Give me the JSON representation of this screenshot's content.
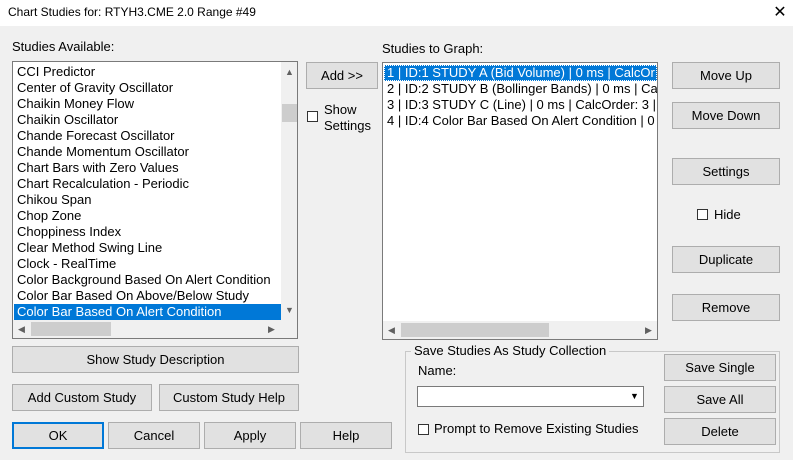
{
  "window": {
    "title": "Chart Studies for: RTYH3.CME  2.0 Range  #49",
    "close_glyph": "✕"
  },
  "available": {
    "label": "Studies Available:",
    "items": [
      "CCI Predictor",
      "Center of Gravity Oscillator",
      "Chaikin Money Flow",
      "Chaikin Oscillator",
      "Chande Forecast Oscillator",
      "Chande Momentum Oscillator",
      "Chart Bars with Zero Values",
      "Chart Recalculation - Periodic",
      "Chikou Span",
      "Chop Zone",
      "Choppiness Index",
      "Clear Method Swing Line",
      "Clock - RealTime",
      "Color Background Based On Alert Condition",
      "Color Bar Based On Above/Below Study",
      "Color Bar Based On Alert Condition"
    ],
    "selected_index": 15
  },
  "middle": {
    "add_label": "Add >>",
    "show_settings_label_1": "Show",
    "show_settings_label_2": "Settings"
  },
  "graph": {
    "label": "Studies to Graph:",
    "items": [
      "1 | ID:1  STUDY A (Bid Volume) | 0 ms | CalcOr",
      "2 | ID:2  STUDY B (Bollinger Bands) | 0 ms | Ca",
      "3 | ID:3  STUDY C (Line) | 0 ms | CalcOrder: 3 | S",
      "4 | ID:4  Color Bar Based On Alert Condition | 0"
    ],
    "selected_index": 0
  },
  "right_buttons": {
    "move_up": "Move Up",
    "move_down": "Move Down",
    "settings": "Settings",
    "hide": "Hide",
    "duplicate": "Duplicate",
    "remove": "Remove"
  },
  "left_buttons": {
    "show_description": "Show Study Description",
    "add_custom": "Add Custom Study",
    "custom_help": "Custom Study Help"
  },
  "bottom_buttons": {
    "ok": "OK",
    "cancel": "Cancel",
    "apply": "Apply",
    "help": "Help"
  },
  "collection": {
    "group_title": "Save Studies As Study Collection",
    "name_label": "Name:",
    "name_value": "",
    "prompt_label": "Prompt to Remove Existing Studies",
    "save_single": "Save Single",
    "save_all": "Save All",
    "delete": "Delete"
  },
  "icons": {
    "scroll_up": "▲",
    "scroll_down": "▼",
    "scroll_left": "◀",
    "scroll_right": "▶",
    "combo_arrow": "▼"
  },
  "colors": {
    "selection": "#0078d7",
    "default_button_border": "#0078d7"
  }
}
